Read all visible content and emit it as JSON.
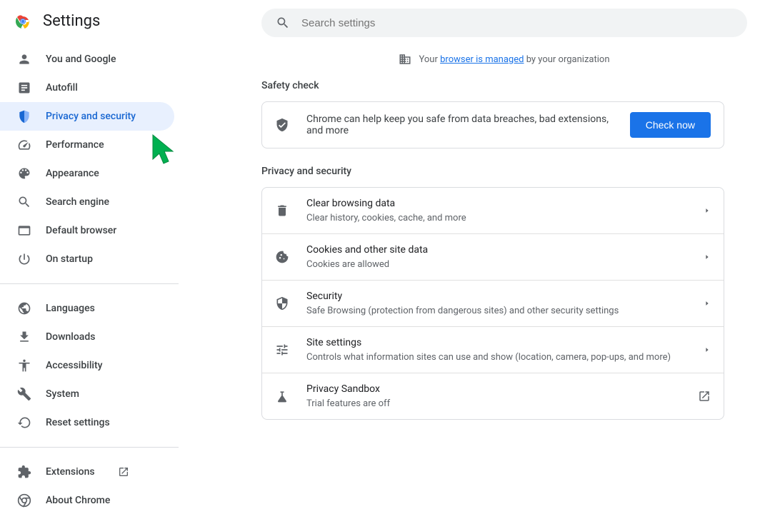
{
  "header": {
    "title": "Settings"
  },
  "search": {
    "placeholder": "Search settings"
  },
  "managed": {
    "prefix": "Your",
    "link": "browser is managed",
    "suffix": "by your organization"
  },
  "nav": {
    "group1": [
      {
        "id": "you-google",
        "label": "You and Google",
        "icon": "person"
      },
      {
        "id": "autofill",
        "label": "Autofill",
        "icon": "autofill"
      },
      {
        "id": "privacy",
        "label": "Privacy and security",
        "icon": "shield",
        "active": true
      },
      {
        "id": "performance",
        "label": "Performance",
        "icon": "speed"
      },
      {
        "id": "appearance",
        "label": "Appearance",
        "icon": "palette"
      },
      {
        "id": "search-engine",
        "label": "Search engine",
        "icon": "search"
      },
      {
        "id": "default-browser",
        "label": "Default browser",
        "icon": "browser"
      },
      {
        "id": "startup",
        "label": "On startup",
        "icon": "power"
      }
    ],
    "group2": [
      {
        "id": "languages",
        "label": "Languages",
        "icon": "globe"
      },
      {
        "id": "downloads",
        "label": "Downloads",
        "icon": "download"
      },
      {
        "id": "accessibility",
        "label": "Accessibility",
        "icon": "accessibility"
      },
      {
        "id": "system",
        "label": "System",
        "icon": "wrench"
      },
      {
        "id": "reset",
        "label": "Reset settings",
        "icon": "reset"
      }
    ],
    "group3": [
      {
        "id": "extensions",
        "label": "Extensions",
        "icon": "extension",
        "external": true
      },
      {
        "id": "about",
        "label": "About Chrome",
        "icon": "chrome"
      }
    ]
  },
  "safety": {
    "section_title": "Safety check",
    "text": "Chrome can help keep you safe from data breaches, bad extensions, and more",
    "button": "Check now"
  },
  "privacy": {
    "section_title": "Privacy and security",
    "rows": [
      {
        "id": "clear-data",
        "icon": "trash",
        "title": "Clear browsing data",
        "sub": "Clear history, cookies, cache, and more",
        "trailing": "arrow"
      },
      {
        "id": "cookies",
        "icon": "cookie",
        "title": "Cookies and other site data",
        "sub": "Cookies are allowed",
        "trailing": "arrow"
      },
      {
        "id": "security",
        "icon": "security",
        "title": "Security",
        "sub": "Safe Browsing (protection from dangerous sites) and other security settings",
        "trailing": "arrow"
      },
      {
        "id": "site-settings",
        "icon": "tune",
        "title": "Site settings",
        "sub": "Controls what information sites can use and show (location, camera, pop-ups, and more)",
        "trailing": "arrow"
      },
      {
        "id": "privacy-sandbox",
        "icon": "flask",
        "title": "Privacy Sandbox",
        "sub": "Trial features are off",
        "trailing": "external"
      }
    ]
  }
}
